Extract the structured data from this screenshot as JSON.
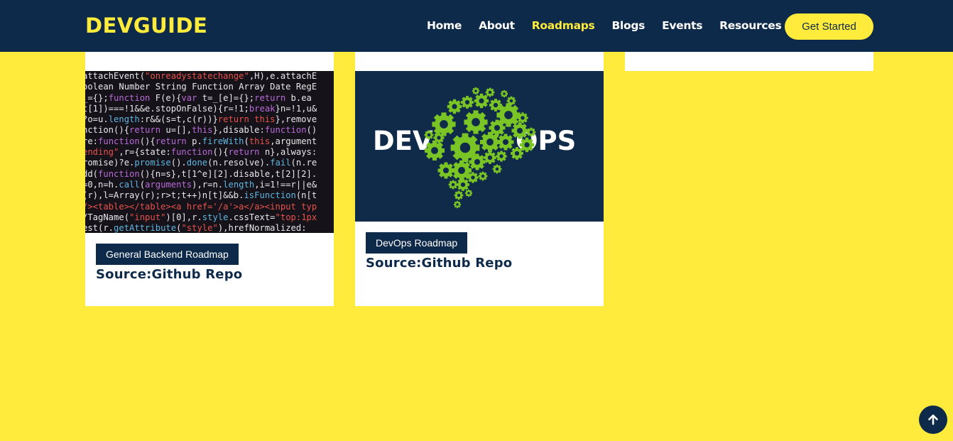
{
  "header": {
    "logo": "DEVGUIDE",
    "nav": [
      {
        "label": "Home"
      },
      {
        "label": "About"
      },
      {
        "label": "Roadmaps",
        "active": true
      },
      {
        "label": "Blogs"
      },
      {
        "label": "Events"
      },
      {
        "label": "Resources",
        "has_dropdown": true
      }
    ],
    "cta_label": "Get Started"
  },
  "cards": [
    {
      "tag": "General Backend Roadmap",
      "source": "Source:Github Repo",
      "image": "code-screenshot",
      "code_lines": [
        [
          [
            "",
            "attachEvent("
          ],
          [
            "r",
            "\"onreadystatechange\""
          ],
          [
            "",
            ",H),e.attachE"
          ]
        ],
        [
          [
            "",
            "oolean Number String Function Array Date RegE"
          ]
        ],
        [
          [
            "",
            "_={};"
          ],
          [
            "p",
            "function"
          ],
          [
            "",
            " F(e){"
          ],
          [
            "p",
            "var"
          ],
          [
            "",
            " t=_[e]={};"
          ],
          [
            "p",
            "return"
          ],
          [
            "",
            " b.ea"
          ]
        ],
        [
          [
            "",
            "t[1])===!1&&e.stopOnFalse){r=!1;"
          ],
          [
            "p",
            "break"
          ],
          [
            "",
            "}n=!1,u&"
          ]
        ],
        [
          [
            "",
            "?o=u."
          ],
          [
            "c",
            "length"
          ],
          [
            "",
            ":r&&(s=t,c(r))}"
          ],
          [
            "r",
            "return this"
          ],
          [
            "",
            "},remove"
          ]
        ],
        [
          [
            "",
            "nction(){"
          ],
          [
            "p",
            "return"
          ],
          [
            "",
            " u=[],"
          ],
          [
            "p",
            "this"
          ],
          [
            "",
            "},disable:"
          ],
          [
            "p",
            "function"
          ],
          [
            "",
            "()"
          ]
        ],
        [
          [
            "",
            "re:"
          ],
          [
            "p",
            "function"
          ],
          [
            "",
            "(){"
          ],
          [
            "p",
            "return"
          ],
          [
            "",
            " p."
          ],
          [
            "c",
            "fireWith"
          ],
          [
            "",
            "("
          ],
          [
            "r",
            "this"
          ],
          [
            "",
            ",argument"
          ]
        ],
        [
          [
            "r",
            "ending\""
          ],
          [
            "",
            ",r={state:"
          ],
          [
            "p",
            "function"
          ],
          [
            "",
            "(){"
          ],
          [
            "p",
            "return"
          ],
          [
            "",
            " n},always:"
          ]
        ],
        [
          [
            "",
            "romise)?e."
          ],
          [
            "c",
            "promise"
          ],
          [
            "",
            "()."
          ],
          [
            "c",
            "done"
          ],
          [
            "",
            "(n.resolve)."
          ],
          [
            "c",
            "fail"
          ],
          [
            "",
            "(n.re"
          ]
        ],
        [
          [
            "",
            "dd("
          ],
          [
            "p",
            "function"
          ],
          [
            "",
            "(){n=s},t[1^e][2].disable,t[2][2]."
          ]
        ],
        [
          [
            "",
            "=0,n=h."
          ],
          [
            "c",
            "call"
          ],
          [
            "",
            "("
          ],
          [
            "p",
            "arguments"
          ],
          [
            "",
            "),r=n."
          ],
          [
            "c",
            "length"
          ],
          [
            "",
            ",i=1!==r||e&"
          ]
        ],
        [
          [
            "",
            "(r),l=Array(r);r>t;t++)n[t]&&b."
          ],
          [
            "c",
            "isFunction"
          ],
          [
            "",
            "(n[t"
          ]
        ],
        [
          [
            "r",
            "/><table></table><a href='/a'>a</a><input typ"
          ]
        ],
        [
          [
            "",
            "/TagName("
          ],
          [
            "r",
            "\"input\""
          ],
          [
            "",
            ")[0],r."
          ],
          [
            "c",
            "style"
          ],
          [
            "",
            ".cssText="
          ],
          [
            "r",
            "\"top:1px"
          ]
        ],
        [
          [
            "",
            "est(r."
          ],
          [
            "c",
            "getAttribute"
          ],
          [
            "",
            "("
          ],
          [
            "r",
            "\"style\""
          ],
          [
            "",
            "),hrefNormalized:"
          ]
        ]
      ]
    },
    {
      "tag": "DevOps Roadmap",
      "source": "Source:Github Repo",
      "image": "devops-logo",
      "logo_left": "DEV",
      "logo_right": "OPS"
    },
    {
      "tag": "",
      "source": "",
      "image": ""
    }
  ],
  "scroll_top_icon": "arrow-up-icon",
  "colors": {
    "background": "#ffeb3b",
    "navy": "#0e2a4a",
    "accent": "#ffeb3b",
    "gear_green": "#7ac425"
  }
}
